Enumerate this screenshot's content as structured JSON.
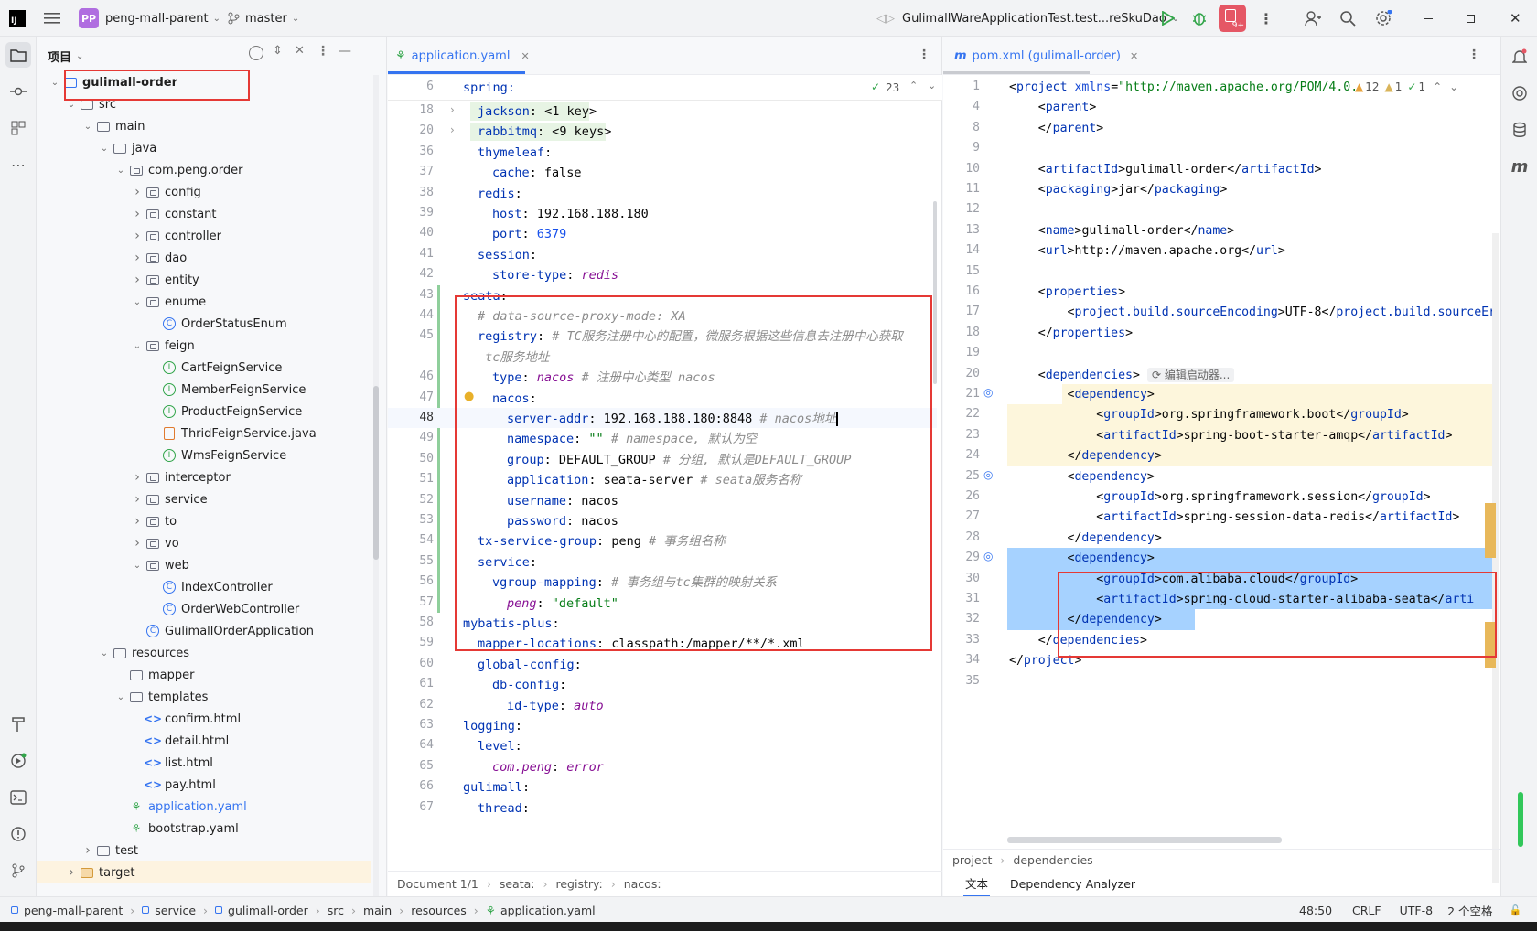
{
  "titlebar": {
    "project_badge": "PP",
    "project": "peng-mall-parent",
    "branch": "master",
    "run_config": "GulimallWareApplicationTest.test...reSkuDao",
    "notif_count": "9+"
  },
  "project_panel": {
    "title": "项目"
  },
  "tree": [
    {
      "label": "gulimall-order",
      "depth": 1,
      "type": "module",
      "chev": "v",
      "bold": true
    },
    {
      "label": "src",
      "depth": 2,
      "type": "folder",
      "chev": "v"
    },
    {
      "label": "main",
      "depth": 3,
      "type": "folder",
      "chev": "v"
    },
    {
      "label": "java",
      "depth": 4,
      "type": "folder",
      "chev": "v"
    },
    {
      "label": "com.peng.order",
      "depth": 5,
      "type": "pkg",
      "chev": "v"
    },
    {
      "label": "config",
      "depth": 6,
      "type": "pkg",
      "chev": ">"
    },
    {
      "label": "constant",
      "depth": 6,
      "type": "pkg",
      "chev": ">"
    },
    {
      "label": "controller",
      "depth": 6,
      "type": "pkg",
      "chev": ">"
    },
    {
      "label": "dao",
      "depth": 6,
      "type": "pkg",
      "chev": ">"
    },
    {
      "label": "entity",
      "depth": 6,
      "type": "pkg",
      "chev": ">"
    },
    {
      "label": "enume",
      "depth": 6,
      "type": "pkg",
      "chev": "v"
    },
    {
      "label": "OrderStatusEnum",
      "depth": 7,
      "type": "class"
    },
    {
      "label": "feign",
      "depth": 6,
      "type": "pkg",
      "chev": "v"
    },
    {
      "label": "CartFeignService",
      "depth": 7,
      "type": "iface"
    },
    {
      "label": "MemberFeignService",
      "depth": 7,
      "type": "iface"
    },
    {
      "label": "ProductFeignService",
      "depth": 7,
      "type": "iface"
    },
    {
      "label": "ThridFeignService.java",
      "depth": 7,
      "type": "java"
    },
    {
      "label": "WmsFeignService",
      "depth": 7,
      "type": "iface"
    },
    {
      "label": "interceptor",
      "depth": 6,
      "type": "pkg",
      "chev": ">"
    },
    {
      "label": "service",
      "depth": 6,
      "type": "pkg",
      "chev": ">"
    },
    {
      "label": "to",
      "depth": 6,
      "type": "pkg",
      "chev": ">"
    },
    {
      "label": "vo",
      "depth": 6,
      "type": "pkg",
      "chev": ">"
    },
    {
      "label": "web",
      "depth": 6,
      "type": "pkg",
      "chev": "v"
    },
    {
      "label": "IndexController",
      "depth": 7,
      "type": "class"
    },
    {
      "label": "OrderWebController",
      "depth": 7,
      "type": "class"
    },
    {
      "label": "GulimallOrderApplication",
      "depth": 6,
      "type": "app"
    },
    {
      "label": "resources",
      "depth": 4,
      "type": "folder",
      "chev": "v"
    },
    {
      "label": "mapper",
      "depth": 5,
      "type": "folder"
    },
    {
      "label": "templates",
      "depth": 5,
      "type": "folder",
      "chev": "v"
    },
    {
      "label": "confirm.html",
      "depth": 6,
      "type": "html"
    },
    {
      "label": "detail.html",
      "depth": 6,
      "type": "html"
    },
    {
      "label": "list.html",
      "depth": 6,
      "type": "html"
    },
    {
      "label": "pay.html",
      "depth": 6,
      "type": "html"
    },
    {
      "label": "application.yaml",
      "depth": 5,
      "type": "yaml",
      "blue": true
    },
    {
      "label": "bootstrap.yaml",
      "depth": 5,
      "type": "yaml"
    },
    {
      "label": "test",
      "depth": 3,
      "type": "folder",
      "chev": ">"
    },
    {
      "label": "target",
      "depth": 2,
      "type": "folder",
      "chev": ">",
      "orange": true
    }
  ],
  "editor1": {
    "tab": "application.yaml",
    "sticky": {
      "num": "6",
      "text": "spring:"
    },
    "inspections": "23",
    "lines": [
      {
        "n": "18",
        "i": 1,
        "k": "jackson",
        "v": " <1 key>",
        "fold": true
      },
      {
        "n": "20",
        "i": 1,
        "k": "rabbitmq",
        "v": " <9 keys>",
        "fold": true
      },
      {
        "n": "36",
        "i": 1,
        "k": "thymeleaf",
        "v": ""
      },
      {
        "n": "37",
        "i": 2,
        "k": "cache",
        "v": " false"
      },
      {
        "n": "38",
        "i": 1,
        "k": "redis",
        "v": ""
      },
      {
        "n": "39",
        "i": 2,
        "k": "host",
        "v": " 192.168.188.180"
      },
      {
        "n": "40",
        "i": 2,
        "k": "port",
        "v": " 6379",
        "vc": "num"
      },
      {
        "n": "41",
        "i": 1,
        "k": "session",
        "v": ""
      },
      {
        "n": "42",
        "i": 2,
        "k": "store-type",
        "v": " redis",
        "vc": "it2"
      },
      {
        "n": "43",
        "i": 0,
        "k": "seata",
        "v": ""
      },
      {
        "n": "44",
        "i": 1,
        "k": "",
        "v": "",
        "c": "# data-source-proxy-mode: XA"
      },
      {
        "n": "45",
        "i": 1,
        "k": "registry",
        "v": "",
        "c": " # TC服务注册中心的配置，微服务根据这些信息去注册中心获取"
      },
      {
        "n": "",
        "i": 1,
        "k": "",
        "v": "",
        "c": " tc服务地址"
      },
      {
        "n": "46",
        "i": 2,
        "k": "type",
        "v": " nacos",
        "vc": "it2",
        "c": " # 注册中心类型 nacos"
      },
      {
        "n": "47",
        "i": 2,
        "k": "nacos",
        "v": ""
      },
      {
        "n": "48",
        "i": 3,
        "k": "server-addr",
        "v": " 192.168.188.180:8848",
        "c": " # nacos地址"
      },
      {
        "n": "49",
        "i": 3,
        "k": "namespace",
        "v": " \"\"",
        "vc": "k2",
        "c": " # namespace, 默认为空"
      },
      {
        "n": "50",
        "i": 3,
        "k": "group",
        "v": " DEFAULT_GROUP",
        "c": " # 分组, 默认是DEFAULT_GROUP"
      },
      {
        "n": "51",
        "i": 3,
        "k": "application",
        "v": " seata-server",
        "c": " # seata服务名称"
      },
      {
        "n": "52",
        "i": 3,
        "k": "username",
        "v": " nacos"
      },
      {
        "n": "53",
        "i": 3,
        "k": "password",
        "v": " nacos"
      },
      {
        "n": "54",
        "i": 1,
        "k": "tx-service-group",
        "v": " peng",
        "c": " # 事务组名称"
      },
      {
        "n": "55",
        "i": 1,
        "k": "service",
        "v": ""
      },
      {
        "n": "56",
        "i": 2,
        "k": "vgroup-mapping",
        "v": "",
        "c": " # 事务组与tc集群的映射关系"
      },
      {
        "n": "57",
        "i": 3,
        "k": "peng",
        "v": " \"default\"",
        "vc": "k2",
        "kit": true
      },
      {
        "n": "58",
        "i": 0,
        "k": "mybatis-plus",
        "v": ""
      },
      {
        "n": "59",
        "i": 1,
        "k": "mapper-locations",
        "v": " classpath:/mapper/**/*.xml"
      },
      {
        "n": "60",
        "i": 1,
        "k": "global-config",
        "v": ""
      },
      {
        "n": "61",
        "i": 2,
        "k": "db-config",
        "v": ""
      },
      {
        "n": "62",
        "i": 3,
        "k": "id-type",
        "v": " auto",
        "vc": "it2"
      },
      {
        "n": "63",
        "i": 0,
        "k": "logging",
        "v": ""
      },
      {
        "n": "64",
        "i": 1,
        "k": "level",
        "v": ""
      },
      {
        "n": "65",
        "i": 2,
        "k": "com.peng",
        "v": " error",
        "vc": "it2",
        "kit": true
      },
      {
        "n": "66",
        "i": 0,
        "k": "gulimall",
        "v": ""
      },
      {
        "n": "67",
        "i": 1,
        "k": "thread",
        "v": ""
      }
    ],
    "breadcrumb": [
      "Document 1/1",
      "seata:",
      "registry:",
      "nacos:"
    ]
  },
  "editor2": {
    "tab": "pom.xml (gulimall-order)",
    "warn": "12",
    "weak": "1",
    "ok": "1",
    "lines": [
      {
        "n": "1",
        "t": "<project xmlns=\"http://maven.apache.org/POM/4.0.("
      },
      {
        "n": "4",
        "t": "    <parent>"
      },
      {
        "n": "8",
        "t": "    </parent>"
      },
      {
        "n": "9",
        "t": ""
      },
      {
        "n": "10",
        "t": "    <artifactId>gulimall-order</artifactId>"
      },
      {
        "n": "11",
        "t": "    <packaging>jar</packaging>"
      },
      {
        "n": "12",
        "t": ""
      },
      {
        "n": "13",
        "t": "    <name>gulimall-order</name>"
      },
      {
        "n": "14",
        "t": "    <url>http://maven.apache.org</url>"
      },
      {
        "n": "15",
        "t": ""
      },
      {
        "n": "16",
        "t": "    <properties>"
      },
      {
        "n": "17",
        "t": "        <project.build.sourceEncoding>UTF-8</project.build.sourceEr"
      },
      {
        "n": "18",
        "t": "    </properties>"
      },
      {
        "n": "19",
        "t": ""
      },
      {
        "n": "20",
        "t": "    <dependencies>",
        "hint": "编辑启动器..."
      },
      {
        "n": "21",
        "t": "        <dependency>"
      },
      {
        "n": "22",
        "t": "            <groupId>org.springframework.boot</groupId>"
      },
      {
        "n": "23",
        "t": "            <artifactId>spring-boot-starter-amqp</artifactId>"
      },
      {
        "n": "24",
        "t": "        </dependency>"
      },
      {
        "n": "25",
        "t": "        <dependency>"
      },
      {
        "n": "26",
        "t": "            <groupId>org.springframework.session</groupId>"
      },
      {
        "n": "27",
        "t": "            <artifactId>spring-session-data-redis</artifactId>"
      },
      {
        "n": "28",
        "t": "        </dependency>"
      },
      {
        "n": "29",
        "t": "        <dependency>"
      },
      {
        "n": "30",
        "t": "            <groupId>com.alibaba.cloud</groupId>"
      },
      {
        "n": "31",
        "t": "            <artifactId>spring-cloud-starter-alibaba-seata</arti"
      },
      {
        "n": "32",
        "t": "        </dependency>"
      },
      {
        "n": "33",
        "t": "    </dependencies>"
      },
      {
        "n": "34",
        "t": "</project>"
      },
      {
        "n": "35",
        "t": ""
      }
    ],
    "breadcrumb": [
      "project",
      "dependencies"
    ],
    "bottom_tabs": [
      "文本",
      "Dependency Analyzer"
    ]
  },
  "statusbar": {
    "path": [
      "peng-mall-parent",
      "service",
      "gulimall-order",
      "src",
      "main",
      "resources",
      "application.yaml"
    ],
    "pos": "48:50",
    "sep": "CRLF",
    "enc": "UTF-8",
    "indent": "2 个空格"
  },
  "colors": {
    "accent": "#3574f0",
    "red_box": "#e53935",
    "selection": "#a6d2ff",
    "highlight": "#fdf6dc"
  }
}
